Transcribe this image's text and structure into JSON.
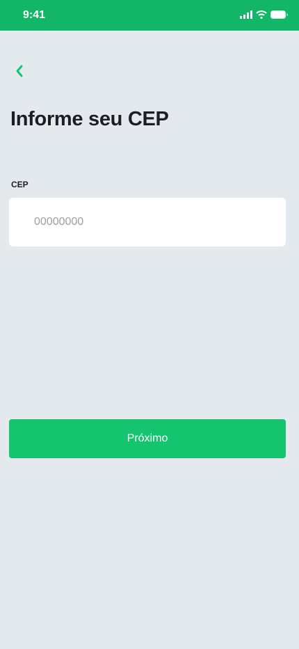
{
  "status_bar": {
    "time": "9:41"
  },
  "page": {
    "title": "Informe seu CEP"
  },
  "form": {
    "cep_label": "CEP",
    "cep_placeholder": "00000000",
    "cep_value": ""
  },
  "actions": {
    "next_label": "Próximo"
  },
  "colors": {
    "brand": "#13b566",
    "button": "#14c46e",
    "background": "#e4e9ed"
  }
}
